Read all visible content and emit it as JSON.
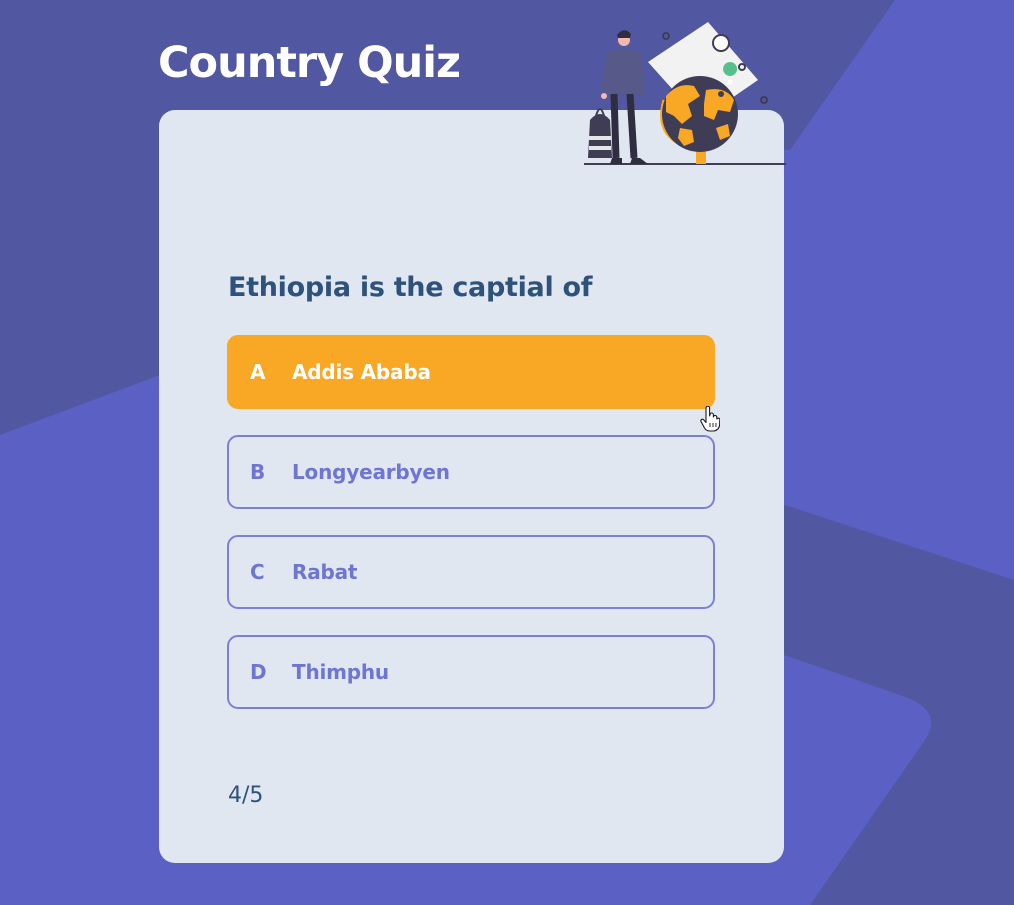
{
  "app": {
    "title": "Country Quiz"
  },
  "quiz": {
    "question": "Ethiopia is the captial of",
    "options": [
      {
        "letter": "A",
        "text": "Addis Ababa",
        "selected": true
      },
      {
        "letter": "B",
        "text": "Longyearbyen",
        "selected": false
      },
      {
        "letter": "C",
        "text": "Rabat",
        "selected": false
      },
      {
        "letter": "D",
        "text": "Thimphu",
        "selected": false
      }
    ],
    "progress": "4/5"
  },
  "colors": {
    "background": "#5b61c4",
    "background_shape": "#5157a0",
    "card": "#e0e7f0",
    "accent": "#f9a826",
    "option_border": "#7c80d8",
    "question_text": "#2f527b"
  },
  "icons": {
    "illustration": "traveler-with-globe-illustration",
    "cursor": "hand-pointer-cursor"
  }
}
